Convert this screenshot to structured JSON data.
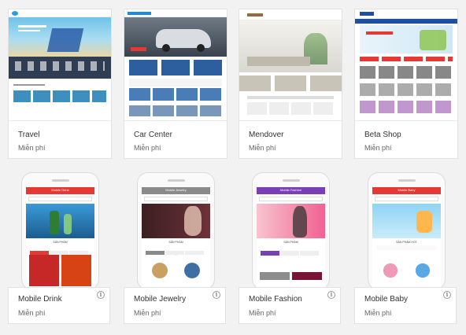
{
  "templates": [
    {
      "name": "Travel",
      "price": "Miễn phí",
      "kind": "desktop"
    },
    {
      "name": "Car Center",
      "price": "Miễn phí",
      "kind": "desktop"
    },
    {
      "name": "Mendover",
      "price": "Miễn phí",
      "kind": "desktop"
    },
    {
      "name": "Beta Shop",
      "price": "Miễn phí",
      "kind": "desktop"
    },
    {
      "name": "Mobile Drink",
      "price": "Miễn phí",
      "kind": "mobile",
      "header": "Mobile Drink",
      "accent": "#e53935"
    },
    {
      "name": "Mobile Jewelry",
      "price": "Miễn phí",
      "kind": "mobile",
      "header": "Mobile Jewelry",
      "accent": "#9e9e9e"
    },
    {
      "name": "Mobile Fashion",
      "price": "Miễn phí",
      "kind": "mobile",
      "header": "Mobile Fashion",
      "accent": "#7b3fb5"
    },
    {
      "name": "Mobile Baby",
      "price": "Miễn phí",
      "kind": "mobile",
      "header": "Mobile Baby",
      "accent": "#e53935"
    }
  ],
  "info_icon": "info-icon"
}
